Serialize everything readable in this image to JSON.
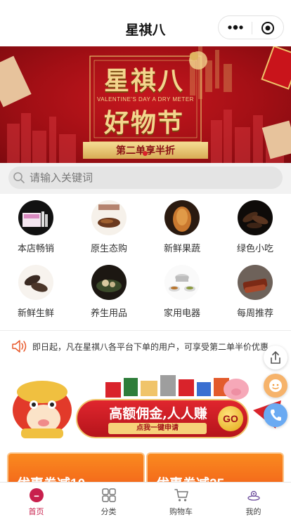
{
  "header": {
    "title": "星祺八"
  },
  "banner": {
    "title_line1": "星祺八",
    "subtitle": "VALENTINE'S DAY A DRY METER",
    "title_line2": "好物节",
    "ribbon": "第二单享半折",
    "colors": {
      "background": "#b3131a",
      "gold": "#f3d58d"
    }
  },
  "search": {
    "placeholder": "请输入关键词",
    "value": ""
  },
  "categories": [
    {
      "label": "本店畅销",
      "icon": "product-box-image"
    },
    {
      "label": "原生态购",
      "icon": "dried-food-image"
    },
    {
      "label": "新鲜果蔬",
      "icon": "roast-food-image"
    },
    {
      "label": "绿色小吃",
      "icon": "sea-cucumber-image"
    },
    {
      "label": "新鲜生鲜",
      "icon": "dried-seafood-image"
    },
    {
      "label": "养生用品",
      "icon": "health-food-image"
    },
    {
      "label": "家用电器",
      "icon": "kitchenware-image"
    },
    {
      "label": "每周推荐",
      "icon": "sliced-meat-image"
    }
  ],
  "notice": {
    "text": "即日起，凡在星祺八各平台下单的用户，可享受第二单半价优惠"
  },
  "promo": {
    "main": "高额佣金,人人赚",
    "sub": "点我一键申请",
    "go": "GO"
  },
  "coupons": [
    {
      "label": "优惠券减10"
    },
    {
      "label": "优惠券减25"
    }
  ],
  "floating": [
    "share-icon",
    "service-icon",
    "phone-icon"
  ],
  "tabbar": [
    {
      "label": "首页",
      "icon": "home-icon",
      "active": true
    },
    {
      "label": "分类",
      "icon": "grid-icon",
      "active": false
    },
    {
      "label": "购物车",
      "icon": "cart-icon",
      "active": false
    },
    {
      "label": "我的",
      "icon": "profile-icon",
      "active": false
    }
  ],
  "theme": {
    "accent": "#c8204d",
    "notice_icon": "#e8582a"
  }
}
